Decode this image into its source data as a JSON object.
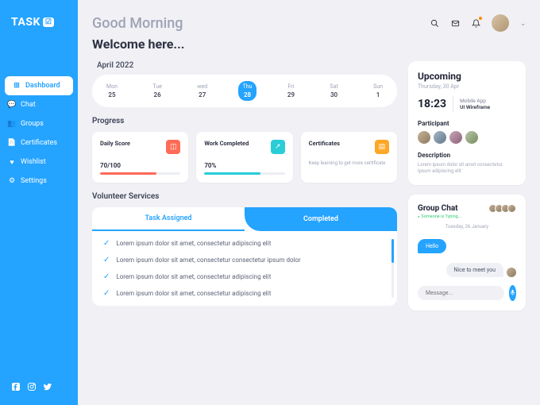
{
  "brand": {
    "name": "TASK"
  },
  "nav": {
    "items": [
      {
        "label": "Dashboard",
        "icon": "⊞"
      },
      {
        "label": "Chat",
        "icon": "💬"
      },
      {
        "label": "Groups",
        "icon": "👥"
      },
      {
        "label": "Certificates",
        "icon": "📄"
      },
      {
        "label": "Wishlist",
        "icon": "♥"
      },
      {
        "label": "Settings",
        "icon": "⚙"
      }
    ]
  },
  "header": {
    "greeting": "Good Morning",
    "welcome": "Welcome here..."
  },
  "calendar": {
    "month": "April 2022",
    "days": [
      {
        "name": "Mon",
        "num": "25"
      },
      {
        "name": "Tue",
        "num": "26"
      },
      {
        "name": "wed",
        "num": "27"
      },
      {
        "name": "Thu",
        "num": "28"
      },
      {
        "name": "Fri",
        "num": "29"
      },
      {
        "name": "Sat",
        "num": "30"
      },
      {
        "name": "Sun",
        "num": "1"
      }
    ]
  },
  "progress": {
    "title": "Progress",
    "cards": [
      {
        "title": "Daily Score",
        "value": "70/100"
      },
      {
        "title": "Work Completed",
        "value": "70%"
      },
      {
        "title": "Certificates",
        "subtitle": "Keep learning to get more certificate"
      }
    ]
  },
  "volunteer": {
    "title": "Volunteer Services",
    "tabs": {
      "a": "Task Assigned",
      "b": "Completed"
    },
    "tasks": [
      "Lorem ipsum dolor sit amet, consectetur adipiscing elit",
      "Lorem ipsum dolor sit amet, consectetur  consectetur  ipsum dolor",
      "Lorem ipsum dolor sit amet, consectetur adipiscing elit",
      "Lorem ipsum dolor sit amet, consectetur adipiscing elit"
    ]
  },
  "upcoming": {
    "title": "Upcoming",
    "date": "Thursday, 30 Apr",
    "time": "18:23",
    "event_line1": "Mobile App",
    "event_line2": "UI Wireframe",
    "participant_label": "Participant",
    "description_label": "Description",
    "description": "Lorem ipsum dolor sit amet consectetur. Ipsum adipiscing elit"
  },
  "chat": {
    "title": "Group Chat",
    "typing": "Someone is Typing...",
    "date": "Tuesday, 26 January",
    "messages": [
      {
        "text": "Hello",
        "type": "sent"
      },
      {
        "text": "Nice to meet you",
        "type": "recv"
      }
    ],
    "composer_placeholder": "Message..."
  }
}
